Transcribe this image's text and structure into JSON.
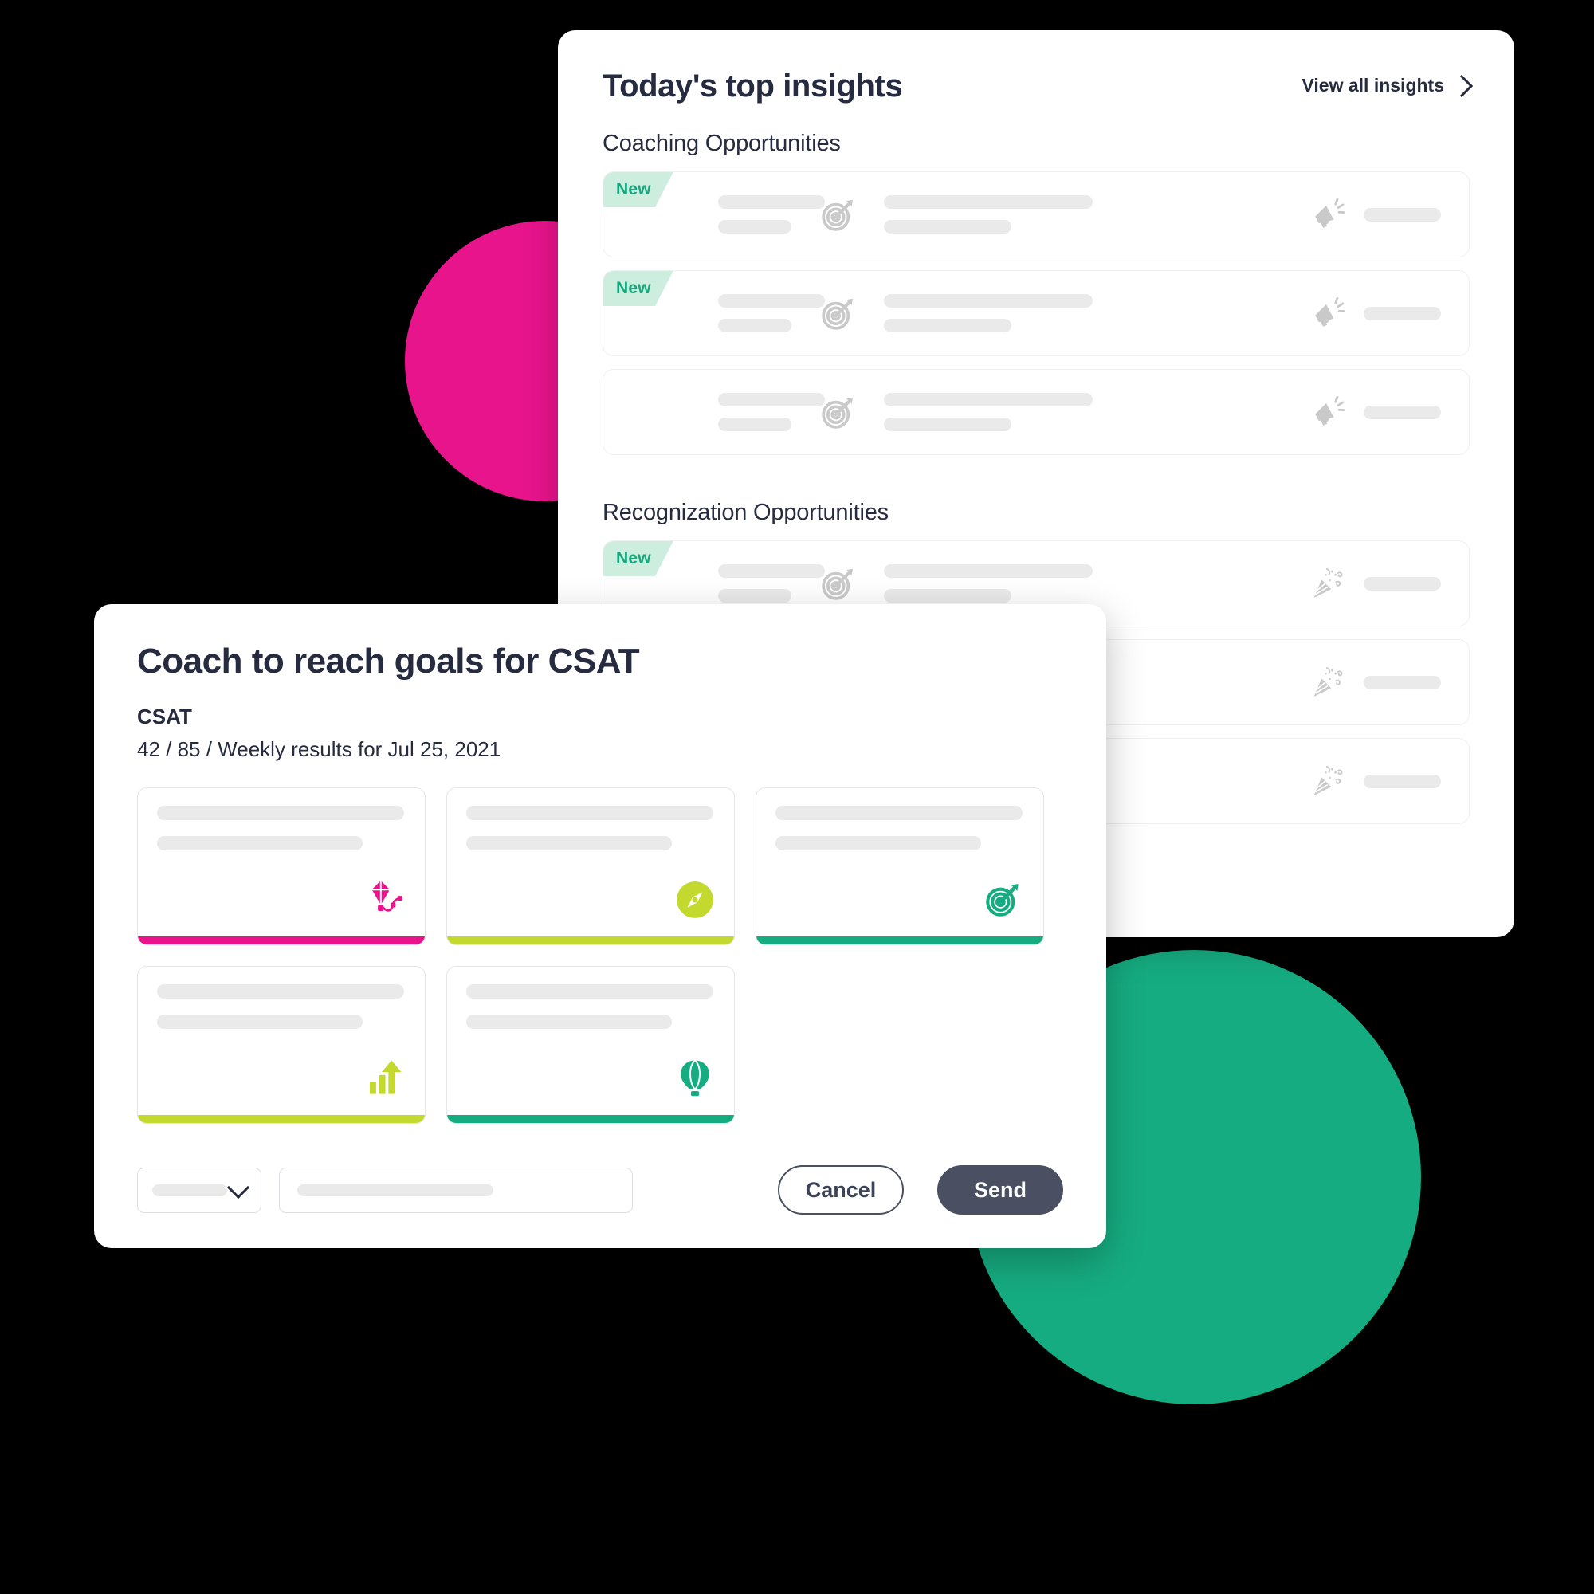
{
  "colors": {
    "background": "#000000",
    "blob_pink": "#E8148C",
    "blob_green": "#16AC81",
    "text_dark": "#262B3F",
    "badge_bg": "#CDEDDF",
    "badge_text": "#16A67C",
    "skeleton": "#EAEAEA",
    "accent_pink": "#E8148C",
    "accent_lime": "#C4D92E",
    "accent_teal": "#16AC81",
    "send_button": "#4A5062",
    "icon_gray": "#C9C9C9"
  },
  "insights_panel": {
    "title": "Today's top insights",
    "view_all_label": "View all insights",
    "view_all_icon": "chevron-right-icon",
    "sections": [
      {
        "heading": "Coaching Opportunities",
        "row_icon": "target-icon",
        "action_icon": "megaphone-icon",
        "rows": [
          {
            "badge": "New",
            "has_badge": true
          },
          {
            "badge": "New",
            "has_badge": true
          },
          {
            "badge": "",
            "has_badge": false
          }
        ]
      },
      {
        "heading": "Recognization Opportunities",
        "row_icon": "target-icon",
        "action_icon": "confetti-icon",
        "rows": [
          {
            "badge": "New",
            "has_badge": true
          },
          {
            "badge": "",
            "has_badge": false
          },
          {
            "badge": "",
            "has_badge": false
          }
        ]
      }
    ]
  },
  "modal": {
    "title": "Coach to reach goals for CSAT",
    "metric_label": "CSAT",
    "subtitle": "42 / 85 / Weekly results for Jul 25, 2021",
    "template_cards": [
      {
        "icon": "kite-icon",
        "accent": "#E8148C",
        "icon_style": "plain"
      },
      {
        "icon": "compass-icon",
        "accent": "#C4D92E",
        "icon_style": "circle"
      },
      {
        "icon": "target-icon",
        "accent": "#16AC81",
        "icon_style": "plain"
      },
      {
        "icon": "bar-chart-up-icon",
        "accent": "#C4D92E",
        "icon_style": "plain"
      },
      {
        "icon": "hot-air-balloon-icon",
        "accent": "#16AC81",
        "icon_style": "plain"
      }
    ],
    "footer": {
      "select_placeholder": "",
      "select_icon": "chevron-down-icon",
      "text_placeholder": "",
      "cancel_label": "Cancel",
      "send_label": "Send"
    }
  }
}
